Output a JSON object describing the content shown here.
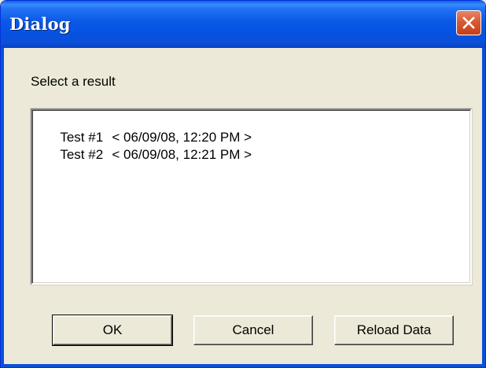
{
  "window": {
    "title": "Dialog",
    "close_icon": "close-icon",
    "title_color": "#ffffff",
    "titlebar_color": "#0a5fe8",
    "close_color": "#d95a34"
  },
  "prompt": "Select a result",
  "results": [
    {
      "name": "Test #1",
      "timestamp": "< 06/09/08, 12:20 PM >"
    },
    {
      "name": "Test #2",
      "timestamp": "< 06/09/08, 12:21 PM >"
    }
  ],
  "buttons": {
    "ok": "OK",
    "cancel": "Cancel",
    "reload": "Reload Data"
  }
}
